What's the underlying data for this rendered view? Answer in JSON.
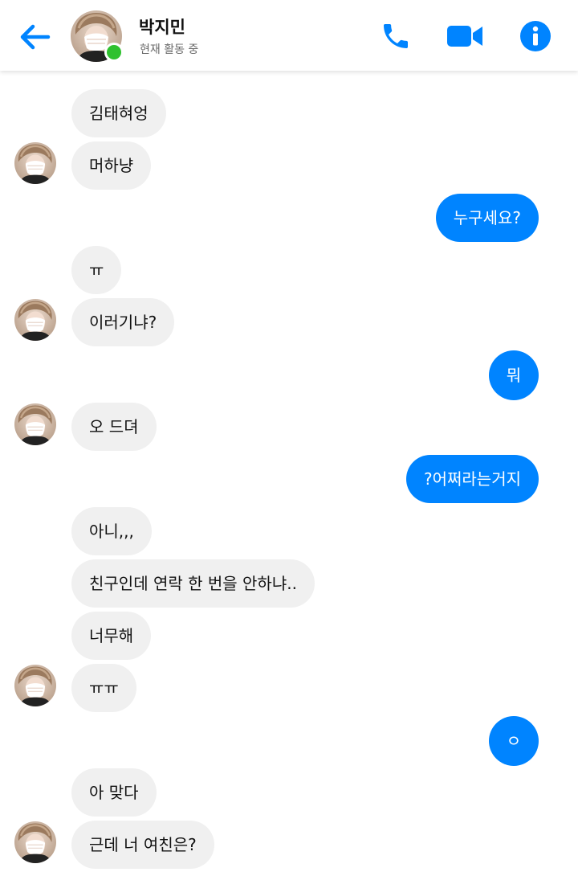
{
  "header": {
    "contact_name": "박지민",
    "status": "현재 활동 중",
    "back_icon": "back-arrow-icon",
    "call_icon": "phone-icon",
    "video_icon": "video-camera-icon",
    "info_icon": "info-icon",
    "accent_color": "#0084ff",
    "online_color": "#2fc12f"
  },
  "messages": [
    {
      "from": "them",
      "text": "김태혀엉"
    },
    {
      "from": "them",
      "text": "머하냥"
    },
    {
      "from": "me",
      "text": "누구세요?"
    },
    {
      "from": "them",
      "text": "ㅠ"
    },
    {
      "from": "them",
      "text": "이러기냐?"
    },
    {
      "from": "me",
      "text": "뭐"
    },
    {
      "from": "them",
      "text": "오 드뎌"
    },
    {
      "from": "me",
      "text": "?어쩌라는거지"
    },
    {
      "from": "them",
      "text": "아니,,,"
    },
    {
      "from": "them",
      "text": "친구인데 연락 한 번을 안하냐.."
    },
    {
      "from": "them",
      "text": "너무해"
    },
    {
      "from": "them",
      "text": "ㅠㅠ"
    },
    {
      "from": "me",
      "text": "ㅇ"
    },
    {
      "from": "them",
      "text": "아 맞다"
    },
    {
      "from": "them",
      "text": "근데 너 여친은?"
    }
  ],
  "colors": {
    "incoming_bubble": "#f0f0f0",
    "outgoing_bubble": "#0084ff"
  }
}
